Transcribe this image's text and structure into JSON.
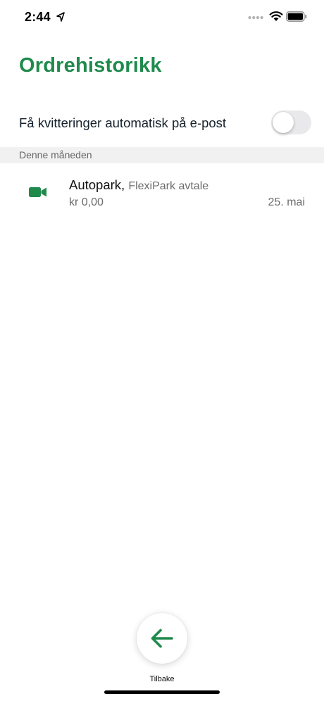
{
  "status_bar": {
    "time": "2:44"
  },
  "header": {
    "title": "Ordrehistorikk"
  },
  "settings": {
    "auto_receipt_label": "Få kvitteringer automatisk på e-post",
    "auto_receipt_enabled": false
  },
  "sections": [
    {
      "header": "Denne måneden",
      "orders": [
        {
          "icon": "video-camera-icon",
          "title": "Autopark,",
          "subtitle": "FlexiPark avtale",
          "price": "kr 0,00",
          "date": "25. mai"
        }
      ]
    }
  ],
  "footer": {
    "back_label": "Tilbake"
  },
  "colors": {
    "accent": "#1f8a4c",
    "section_bg": "#f1f1f1",
    "toggle_off": "#e9e9eb"
  }
}
